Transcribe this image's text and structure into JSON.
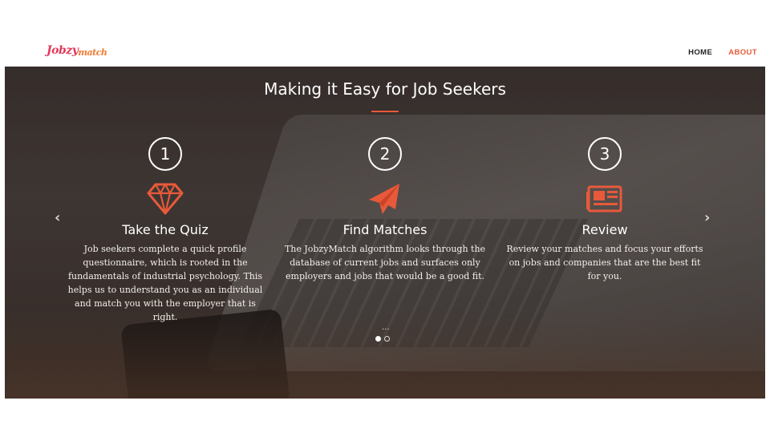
{
  "logo": {
    "primary": "Jobzy",
    "secondary": "match"
  },
  "nav": {
    "items": [
      {
        "label": "HOME",
        "active": false
      },
      {
        "label": "ABOUT",
        "active": true
      }
    ]
  },
  "hero": {
    "title": "Making it Easy for Job Seekers",
    "columns": [
      {
        "number": "1",
        "icon": "diamond-icon",
        "title": "Take the Quiz",
        "text": "Job seekers complete a quick profile questionnaire, which is rooted in the fundamentals of industrial psychology. This helps us to understand you as an individual and match you with the employer that is right."
      },
      {
        "number": "2",
        "icon": "paper-plane-icon",
        "title": "Find Matches",
        "text": "The JobzyMatch algorithm looks through the database of current jobs and surfaces only employers and jobs that would be a good fit."
      },
      {
        "number": "3",
        "icon": "newspaper-icon",
        "title": "Review",
        "text": "Review your matches and focus your efforts on jobs and companies that are the best fit for you."
      }
    ],
    "prev_arrow": "‹",
    "next_arrow": "›",
    "ellipsis": "...",
    "carousel": {
      "slides": 2,
      "active_index": 0
    }
  },
  "colors": {
    "accent": "#e8593a",
    "logo_pink": "#e23a5a"
  }
}
